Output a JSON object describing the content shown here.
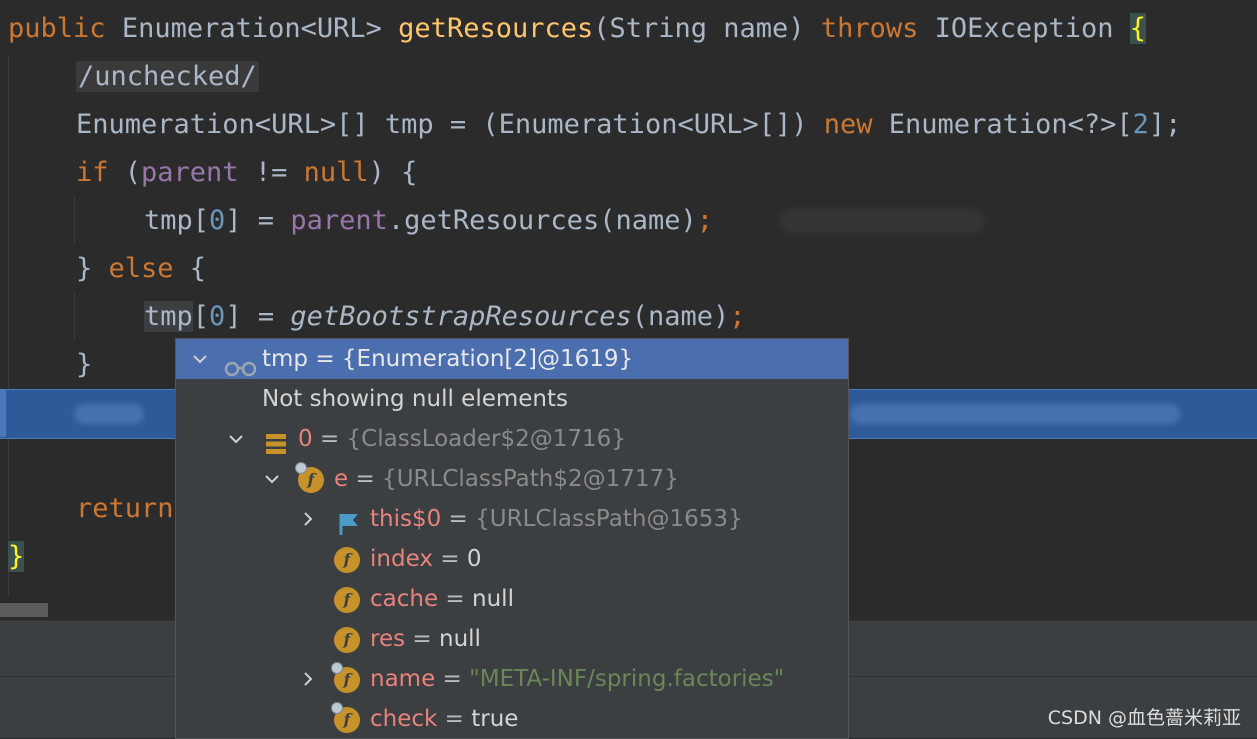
{
  "code": {
    "line1": {
      "kw_public": "public",
      "type": "Enumeration<URL>",
      "method": "getResources",
      "params": "(String name)",
      "kw_throws": "throws",
      "exception": "IOException",
      "brace": "{"
    },
    "line2": {
      "annotation": "/unchecked/"
    },
    "line3": {
      "decl": "Enumeration<URL>[] tmp = (Enumeration<URL>[]) ",
      "kw_new": "new",
      "type": " Enumeration<?>[",
      "num": "2",
      "end": "];"
    },
    "line4": {
      "kw_if": "if",
      "open": " (",
      "field": "parent",
      "op": " != ",
      "kw_null": "null",
      "close": ") {"
    },
    "line5": {
      "lhs_pre": "tmp[",
      "num": "0",
      "lhs_post": "] = ",
      "field": "parent",
      "call": ".getResources(name)",
      "semi": ";"
    },
    "line6": {
      "pre": "} ",
      "kw_else": "else",
      "post": " {"
    },
    "line7": {
      "var": "tmp",
      "lhs_pre": "[",
      "num": "0",
      "lhs_post": "] = ",
      "call": "getBootstrapResources",
      "args": "(name)",
      "semi": ";"
    },
    "line8": {
      "text": "}"
    },
    "line10": {
      "kw_return": "return"
    },
    "line11": {
      "brace": "}"
    }
  },
  "popup": {
    "root": {
      "text": "tmp = {Enumeration[2]@1619}"
    },
    "note": "Not showing null elements",
    "item0": {
      "name": "0",
      "eq": " = ",
      "value": "{ClassLoader$2@1716}"
    },
    "item_e": {
      "name": "e",
      "eq": " = ",
      "value": "{URLClassPath$2@1717}"
    },
    "item_this": {
      "name": "this$0",
      "eq": " = ",
      "value": "{URLClassPath@1653}"
    },
    "item_index": {
      "name": "index",
      "eq": " = ",
      "value": "0"
    },
    "item_cache": {
      "name": "cache",
      "eq": " = ",
      "value": "null"
    },
    "item_res": {
      "name": "res",
      "eq": " = ",
      "value": "null"
    },
    "item_name": {
      "name": "name",
      "eq": " = ",
      "value": "\"META-INF/spring.factories\""
    },
    "item_check": {
      "name": "check",
      "eq": " = ",
      "value": "true"
    }
  },
  "watermark": "CSDN @血色蔷米莉亚",
  "colors": {
    "editor_bg": "#2b2b2b",
    "keyword": "#cc7832",
    "method": "#ffc66d",
    "field": "#9876aa",
    "number": "#6897bb",
    "selection": "#4b6eaf",
    "execution_line": "#2d5a99"
  }
}
